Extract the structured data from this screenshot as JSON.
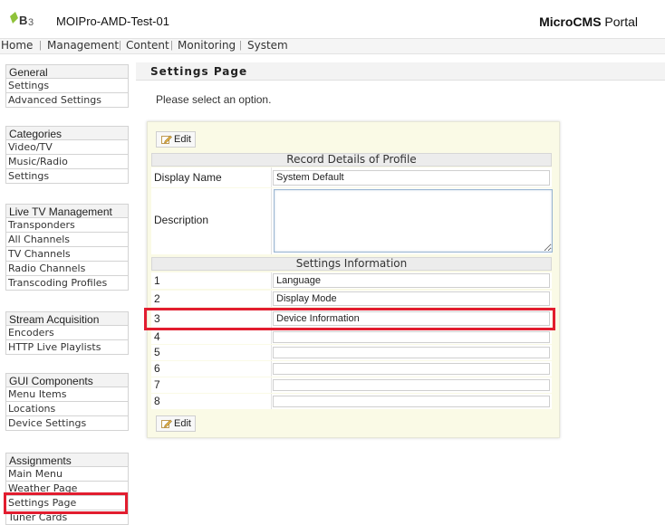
{
  "header": {
    "app_title": "MOIPro-AMD-Test-01",
    "portal_bold": "MicroCMS",
    "portal_light": "Portal"
  },
  "nav": {
    "items": [
      "Home",
      "Management",
      "Content",
      "Monitoring",
      "System"
    ],
    "separator": "|"
  },
  "sidebar": {
    "groups": [
      {
        "title": "General",
        "items": [
          "Settings",
          "Advanced Settings"
        ]
      },
      {
        "title": "Categories",
        "items": [
          "Video/TV",
          "Music/Radio",
          "Settings"
        ]
      },
      {
        "title": "Live TV Management",
        "items": [
          "Transponders",
          "All Channels",
          "TV Channels",
          "Radio Channels",
          "Transcoding Profiles"
        ]
      },
      {
        "title": "Stream Acquisition",
        "items": [
          "Encoders",
          "HTTP Live Playlists"
        ]
      },
      {
        "title": "GUI Components",
        "items": [
          "Menu Items",
          "Locations",
          "Device Settings"
        ]
      },
      {
        "title": "Assignments",
        "items": [
          "Main Menu",
          "Weather Page",
          "Settings Page",
          "Tuner Cards"
        ]
      }
    ]
  },
  "main": {
    "heading": "Settings Page",
    "subtitle": "Please select an option.",
    "edit_label": "Edit",
    "profile_header": "Record Details of Profile",
    "display_name_label": "Display Name",
    "display_name_value": "System Default",
    "description_label": "Description",
    "description_value": "",
    "settings_header": "Settings Information",
    "settings": [
      {
        "num": "1",
        "value": "Language"
      },
      {
        "num": "2",
        "value": "Display Mode"
      },
      {
        "num": "3",
        "value": "Device Information"
      },
      {
        "num": "4",
        "value": ""
      },
      {
        "num": "5",
        "value": ""
      },
      {
        "num": "6",
        "value": ""
      },
      {
        "num": "7",
        "value": ""
      },
      {
        "num": "8",
        "value": ""
      }
    ]
  },
  "colors": {
    "highlight": "#e21d2f",
    "panel_bg": "#fafae6"
  }
}
